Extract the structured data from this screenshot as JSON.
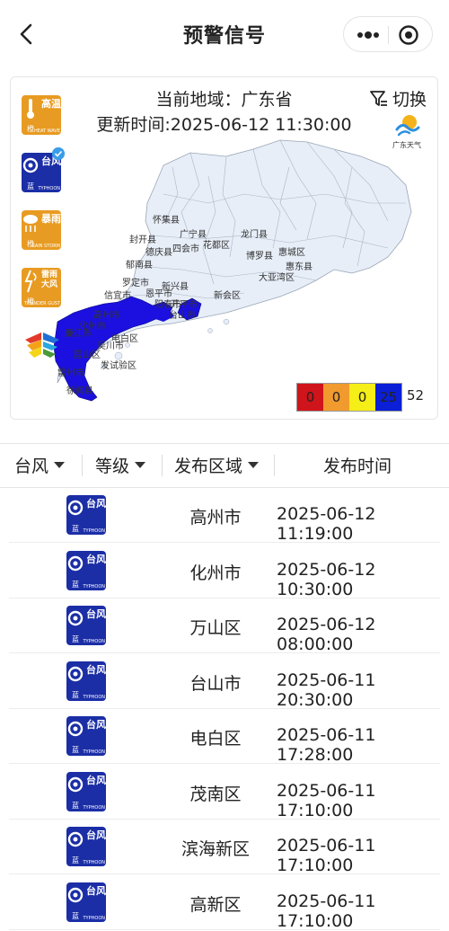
{
  "nav": {
    "title": "预警信号"
  },
  "panel": {
    "region_label": "当前地域：广东省",
    "updated_label": "更新时间:2025-06-12 11:30:00",
    "switch_label": "切换",
    "logo_caption": "广东天气",
    "signals": [
      {
        "ch": "高温",
        "level": "橙",
        "en": "HEAT WAVE",
        "color": "#e89b22"
      },
      {
        "ch": "台风",
        "level": "蓝",
        "en": "TYPHOON",
        "color": "#1b2ea6",
        "selected": true
      },
      {
        "ch": "暴雨",
        "level": "橙",
        "en": "RAIN STORM",
        "color": "#e89b22"
      },
      {
        "ch": "雷雨大风",
        "level": "橙",
        "en": "THUNDER GUST",
        "color": "#e89b22"
      }
    ],
    "legend": [
      {
        "level": "red",
        "count": "0",
        "color": "#d0141b"
      },
      {
        "level": "orange",
        "count": "0",
        "color": "#f19a2d"
      },
      {
        "level": "yellow",
        "count": "0",
        "color": "#f5ee17"
      },
      {
        "level": "blue",
        "count": "25",
        "color": "#0a1fd6"
      }
    ],
    "legend_total": "52",
    "map_labels": [
      "怀集县",
      "广宁县",
      "封开县",
      "龙门县",
      "德庆县",
      "四会市",
      "花都区",
      "博罗县",
      "惠城区",
      "郁南县",
      "罗定市",
      "信宜市",
      "新兴县",
      "开平市",
      "惠东县",
      "大亚湾区",
      "高州市",
      "化州市",
      "廉江市",
      "电白区",
      "吴川市",
      "霞山区",
      "发试验区",
      "雷州市",
      "徐闻县",
      "台山市",
      "阳春市",
      "恩平市",
      "新会区"
    ]
  },
  "filters": {
    "typhoon": "台风",
    "level": "等级",
    "area": "发布区域",
    "time": "发布时间"
  },
  "rows": [
    {
      "signal": "台风",
      "level": "蓝",
      "area": "高州市",
      "time": "2025-06-12 11:19:00"
    },
    {
      "signal": "台风",
      "level": "蓝",
      "area": "化州市",
      "time": "2025-06-12 10:30:00"
    },
    {
      "signal": "台风",
      "level": "蓝",
      "area": "万山区",
      "time": "2025-06-12 08:00:00"
    },
    {
      "signal": "台风",
      "level": "蓝",
      "area": "台山市",
      "time": "2025-06-11 20:30:00"
    },
    {
      "signal": "台风",
      "level": "蓝",
      "area": "电白区",
      "time": "2025-06-11 17:28:00"
    },
    {
      "signal": "台风",
      "level": "蓝",
      "area": "茂南区",
      "time": "2025-06-11 17:10:00"
    },
    {
      "signal": "台风",
      "level": "蓝",
      "area": "滨海新区",
      "time": "2025-06-11 17:10:00"
    },
    {
      "signal": "台风",
      "level": "蓝",
      "area": "高新区",
      "time": "2025-06-11 17:10:00"
    }
  ],
  "icon_en": "TYPHOON"
}
